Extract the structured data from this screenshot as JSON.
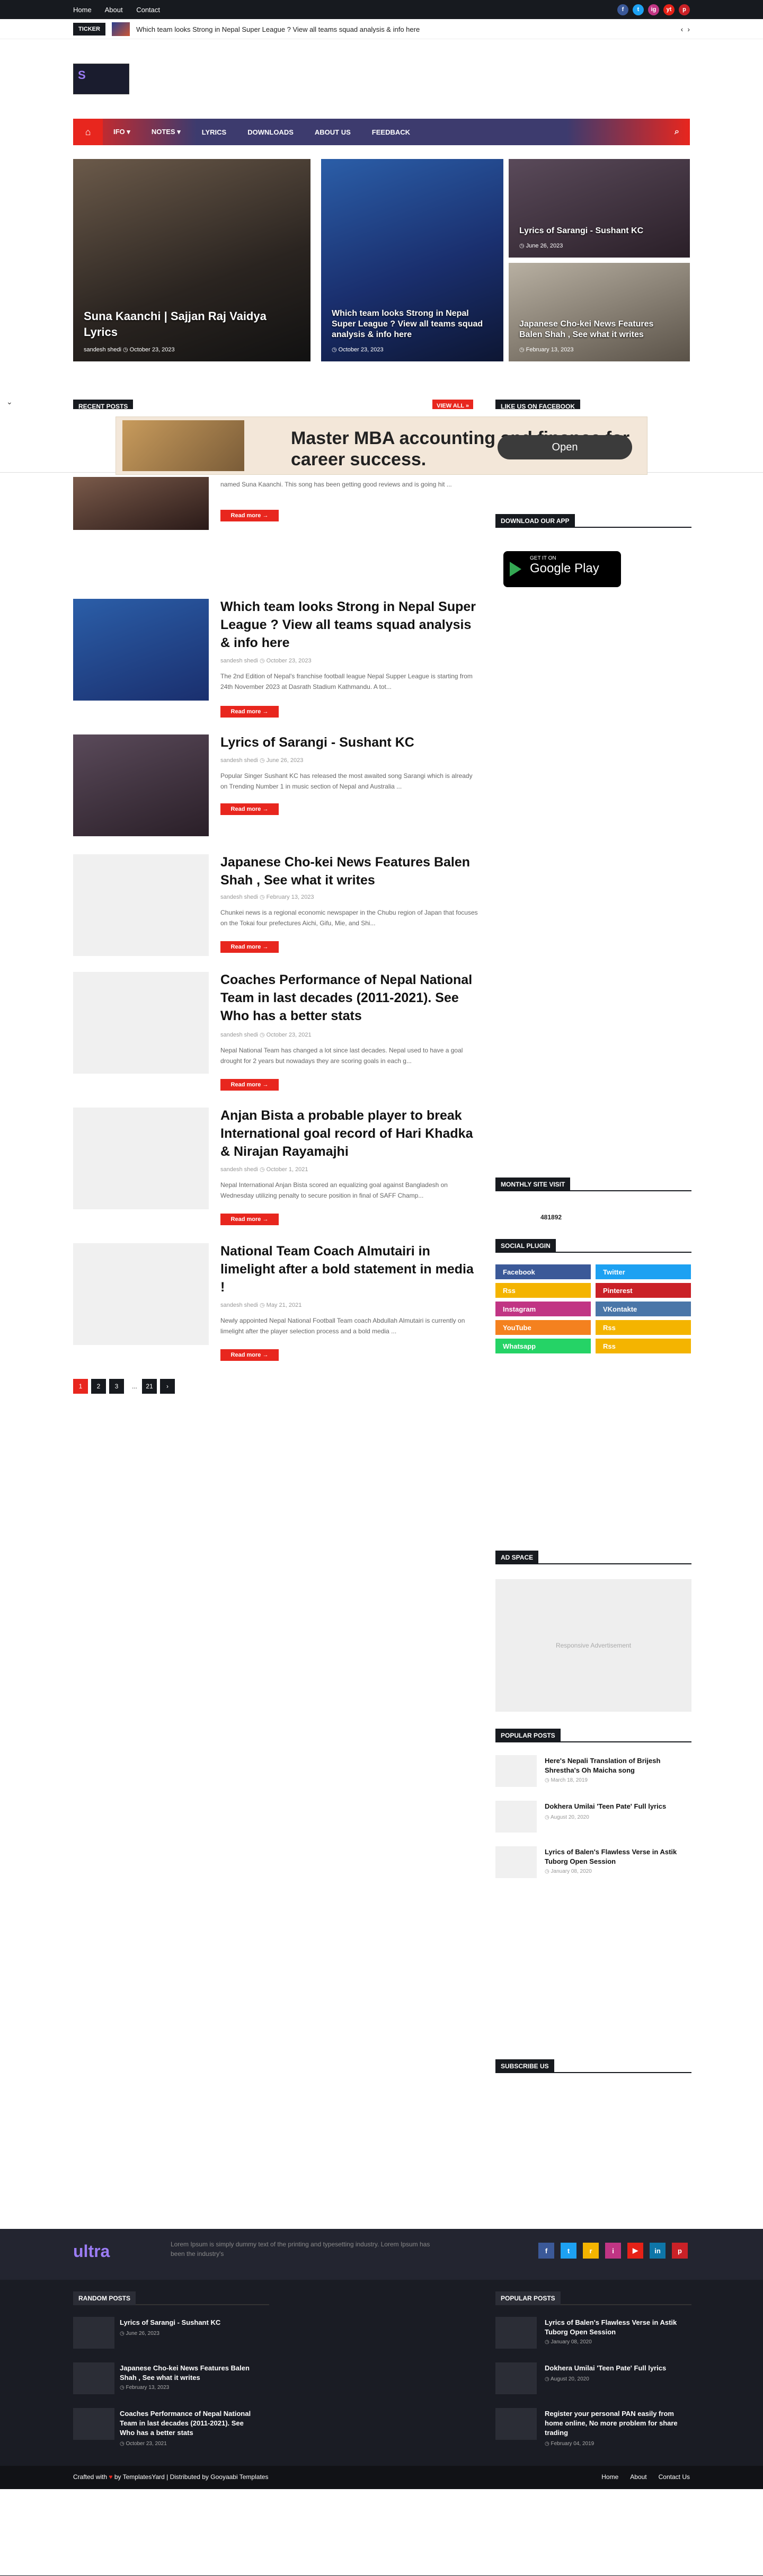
{
  "topbar": {
    "links": [
      "Home",
      "About",
      "Contact"
    ],
    "socials": [
      "f",
      "t",
      "ig",
      "yt",
      "p"
    ]
  },
  "ticker": {
    "label": "TICKER",
    "text": "Which team looks Strong in Nepal Super League ? View all teams squad analysis & info here"
  },
  "logo": {
    "text": "S"
  },
  "nav": {
    "items": [
      "IFO ▾",
      "NOTES ▾",
      "LYRICS",
      "DOWNLOADS",
      "ABOUT US",
      "FEEDBACK"
    ]
  },
  "featured": [
    {
      "title": "Suna Kaanchi | Sajjan Raj Vaidya Lyrics",
      "meta": "sandesh shedi  ◷ October 23, 2023"
    },
    {
      "title": "Which team looks Strong in Nepal Super League ? View all teams squad analysis & info here",
      "meta": "◷ October 23, 2023"
    },
    {
      "title": "Lyrics of Sarangi - Sushant KC",
      "meta": "◷ June 26, 2023"
    },
    {
      "title": "Japanese Cho-kei News Features Balen Shah , See what it writes",
      "meta": "◷ February 13, 2023"
    }
  ],
  "ad": {
    "headline": "Master MBA accounting and finance for career success.",
    "button": "Open"
  },
  "sections": {
    "recent": "RECENT POSTS",
    "view_all": "VIEW ALL »",
    "like_fb": "LIKE US ON FACEBOOK",
    "download_app": "DOWNLOAD OUR APP",
    "monthly": "MONTHLY SITE VISIT",
    "monthly_count": "481892",
    "social": "SOCIAL PLUGIN",
    "ad_space": "AD SPACE",
    "ad_placeholder": "Responsive Advertisement",
    "popular": "POPULAR POSTS",
    "subscribe": "SUBSCRIBE US"
  },
  "google_play": {
    "small": "GET IT ON",
    "big": "Google Play"
  },
  "posts": [
    {
      "title": "",
      "meta": "",
      "snippet": "named Suna Kaanchi. This song has been getting good reviews and is going hit ...",
      "read": "Read more →"
    },
    {
      "title": "Which team looks Strong in Nepal Super League ? View all teams squad analysis & info here",
      "meta": "sandesh shedi  ◷ October 23, 2023",
      "snippet": "The 2nd Edition of Nepal's franchise football league Nepal Supper League is starting from 24th November 2023 at Dasrath Stadium Kathmandu. A tot...",
      "read": "Read more →"
    },
    {
      "title": "Lyrics of Sarangi - Sushant KC",
      "meta": "sandesh shedi  ◷ June 26, 2023",
      "snippet": "Popular Singer Sushant KC has released the most awaited song Sarangi which is already on Trending Number 1 in music section of Nepal and Australia ...",
      "read": "Read more →"
    },
    {
      "title": "Japanese Cho-kei News Features Balen Shah , See what it writes",
      "meta": "sandesh shedi  ◷ February 13, 2023",
      "snippet": "Chunkei news is a regional  economic newspaper in the Chubu region of Japan that focuses on the Tokai four prefectures  Aichi, Gifu, Mie, and Shi...",
      "read": "Read more →"
    },
    {
      "title": "Coaches Performance of Nepal National Team in last decades (2011-2021). See Who has a better stats",
      "meta": "sandesh shedi  ◷ October 23, 2021",
      "snippet": "Nepal National Team has changed a lot since last decades. Nepal used to have a goal drought for 2 years but nowadays they are scoring goals in each g...",
      "read": "Read more →"
    },
    {
      "title": "Anjan Bista a probable player to break International goal record of Hari Khadka & Nirajan Rayamajhi",
      "meta": "sandesh shedi  ◷ October 1, 2021",
      "snippet": "Nepal International Anjan Bista scored an equalizing goal against Bangladesh on Wednesday utilizing penalty to secure position in final of SAFF Champ...",
      "read": "Read more →"
    },
    {
      "title": "National Team Coach Almutairi in limelight after a bold statement in media !",
      "meta": "sandesh shedi  ◷ May 21, 2021",
      "snippet": "Newly appointed Nepal National Football Team coach Abdullah Almutairi is currently on limelight after the player selection process and a bold media ...",
      "read": "Read more →"
    }
  ],
  "pagination": [
    "1",
    "2",
    "3",
    "...",
    "21",
    "›"
  ],
  "social_buttons": [
    {
      "label": "Facebook",
      "color": "#3b5998"
    },
    {
      "label": "Twitter",
      "color": "#1da1f2"
    },
    {
      "label": "Rss",
      "color": "#f4b400"
    },
    {
      "label": "Pinterest",
      "color": "#ca2127"
    },
    {
      "label": "Instagram",
      "color": "#c13584"
    },
    {
      "label": "VKontakte",
      "color": "#4a76a8"
    },
    {
      "label": "YouTube",
      "color": "#f4811f"
    },
    {
      "label": "Rss",
      "color": "#f4b400"
    },
    {
      "label": "Whatsapp",
      "color": "#25d366"
    },
    {
      "label": "Rss",
      "color": "#f4b400"
    }
  ],
  "popular_posts": [
    {
      "title": "Here's Nepali Translation of Brijesh Shrestha's Oh Maicha song",
      "date": "◷ March 18, 2019"
    },
    {
      "title": "Dokhera Umilai 'Teen Pate' Full lyrics",
      "date": "◷ August 20, 2020"
    },
    {
      "title": "Lyrics of Balen's Flawless Verse in Astik Tuborg Open Session",
      "date": "◷ January 08, 2020"
    }
  ],
  "footer": {
    "logo": "ultra",
    "about": "Lorem Ipsum is simply dummy text of the printing and typesetting industry. Lorem Ipsum has been the industry's",
    "random_title": "RANDOM POSTS",
    "popular_title": "POPULAR POSTS",
    "random": [
      {
        "title": "Lyrics of Sarangi - Sushant KC",
        "date": "◷ June 26, 2023"
      },
      {
        "title": "Japanese Cho-kei News Features Balen Shah , See what it writes",
        "date": "◷ February 13, 2023"
      },
      {
        "title": "Coaches Performance of Nepal National Team in last decades (2011-2021). See Who has a better stats",
        "date": "◷ October 23, 2021"
      }
    ],
    "popular": [
      {
        "title": "Lyrics of Balen's Flawless Verse in Astik Tuborg Open Session",
        "date": "◷ January 08, 2020"
      },
      {
        "title": "Dokhera Umilai 'Teen Pate' Full lyrics",
        "date": "◷ August 20, 2020"
      },
      {
        "title": "Register your personal PAN easily from home online, No more problem for share trading",
        "date": "◷ February 04, 2019"
      }
    ],
    "crafted": "Crafted with",
    "by": "by TemplatesYard | Distributed by Gooyaabi Templates",
    "links": [
      "Home",
      "About",
      "Contact Us"
    ]
  }
}
